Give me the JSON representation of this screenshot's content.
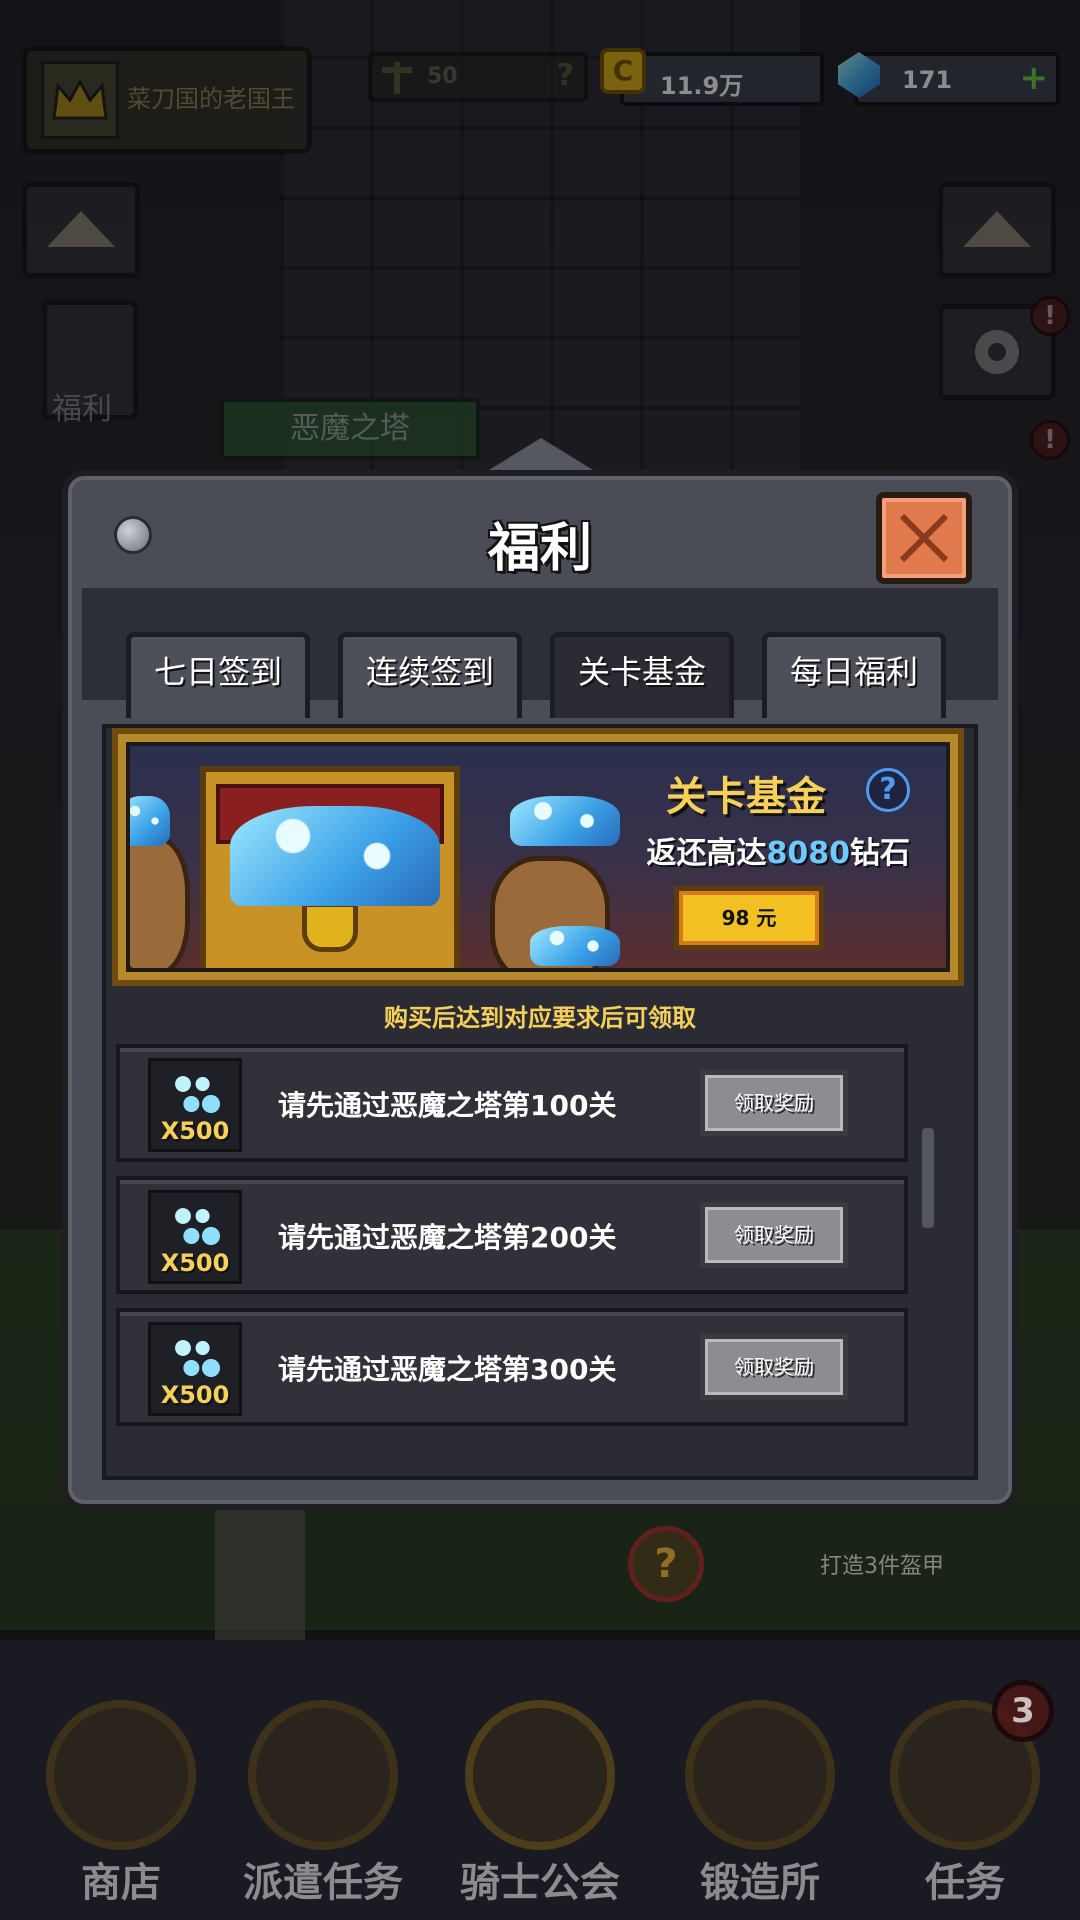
{
  "hud": {
    "player_name": "菜刀国的老国王",
    "power": "50",
    "power_help": "?",
    "coins": "11.9万",
    "coin_symbol": "C",
    "gems": "171",
    "gems_add": "+"
  },
  "background": {
    "welfare_label": "福利",
    "tower_name": "恶魔之塔",
    "alert_mark": "!",
    "task_help": "?",
    "task_text": "打造3件盔甲"
  },
  "modal": {
    "title": "福利",
    "tabs": [
      {
        "label": "七日签到",
        "active": false
      },
      {
        "label": "连续签到",
        "active": false
      },
      {
        "label": "关卡基金",
        "active": true
      },
      {
        "label": "每日福利",
        "active": false
      }
    ],
    "banner": {
      "title": "关卡基金",
      "help": "?",
      "sub_prefix": "返还高达",
      "sub_amount": "8080",
      "sub_suffix": "钻石",
      "price": "98 元"
    },
    "hint": "购买后达到对应要求后可领取",
    "rows": [
      {
        "qty": "X500",
        "text": "请先通过恶魔之塔第100关",
        "button": "领取奖励"
      },
      {
        "qty": "X500",
        "text": "请先通过恶魔之塔第200关",
        "button": "领取奖励"
      },
      {
        "qty": "X500",
        "text": "请先通过恶魔之塔第300关",
        "button": "领取奖励"
      }
    ]
  },
  "nav": {
    "items": [
      {
        "label": "商店"
      },
      {
        "label": "派遣任务"
      },
      {
        "label": "骑士公会"
      },
      {
        "label": "锻造所"
      },
      {
        "label": "任务",
        "badge": "3"
      }
    ]
  },
  "colors": {
    "accent_gold": "#f6d05a",
    "gem_blue": "#6fc8ff",
    "close_orange": "#e07a4c",
    "price_yellow": "#f2c022"
  }
}
